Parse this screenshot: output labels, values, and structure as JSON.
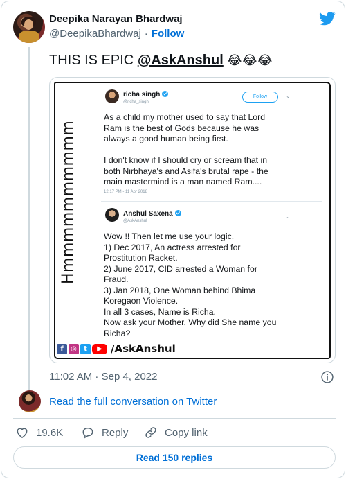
{
  "author": {
    "name": "Deepika Narayan Bhardwaj",
    "handle": "@DeepikaBhardwaj",
    "separator": "·",
    "follow_label": "Follow"
  },
  "tweet": {
    "text_prefix": "THIS IS EPIC ",
    "mention": "@AskAnshul",
    "emojis": "😂😂😂"
  },
  "media": {
    "side_text": "Hmmmmmmmmmm",
    "tweet1": {
      "name": "richa singh",
      "handle": "@richa_singh",
      "follow_label": "Follow",
      "text": "As a child my mother used to say that Lord\nRam is the best of Gods because he was\nalways a good human being first.\n\nI don't know if I should cry or scream that in\nboth Nirbhaya's and Asifa's brutal rape - the\nmain mastermind is a man named Ram....",
      "time": "12:17 PM - 11 Apr 2018"
    },
    "tweet2": {
      "name": "Anshul Saxena",
      "handle": "@AskAnshul",
      "text": "Wow !! Then let me use your logic.\n1) Dec 2017, An actress arrested for\nProstitution Racket.\n2) June 2017, CID arrested a Woman for\nFraud.\n3) Jan 2018, One Woman behind Bhima\nKoregaon Violence.\nIn all 3 cases, Name is Richa.\nNow ask your Mother, Why did She name you\nRicha?"
    },
    "brand": {
      "fb": "f",
      "ig": "◎",
      "tw": "t",
      "yt": "▶",
      "text": "/AskAnshul"
    }
  },
  "meta": {
    "timestamp": "11:02 AM · Sep 4, 2022",
    "conversation_link": "Read the full conversation on Twitter"
  },
  "actions": {
    "like_count": "19.6K",
    "reply_label": "Reply",
    "copy_label": "Copy link"
  },
  "read_replies_label": "Read 150 replies",
  "colors": {
    "link_blue": "#006fd6",
    "twitter_blue": "#1d9bf0",
    "muted": "#536471",
    "border": "#cfd9de"
  }
}
